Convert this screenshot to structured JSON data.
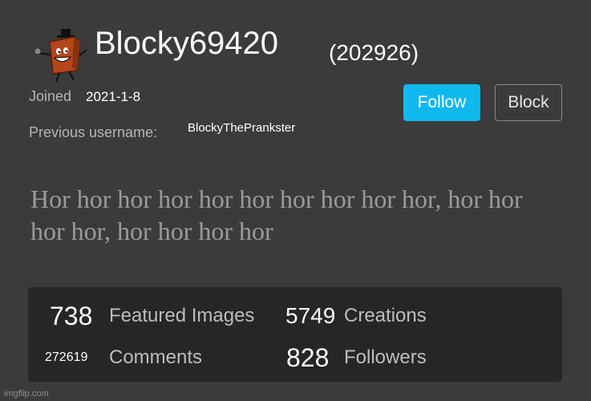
{
  "profile": {
    "username": "Blocky69420",
    "user_id": "(202926)",
    "joined_label": "Joined",
    "joined_date": "2021-1-8",
    "previous_username_label": "Previous username:",
    "previous_username": "BlockyThePrankster",
    "bio": "Hor hor hor hor hor hor hor hor hor hor, hor hor hor hor, hor hor hor hor"
  },
  "actions": {
    "follow_label": "Follow",
    "block_label": "Block"
  },
  "stats": {
    "featured_count": "738",
    "featured_label": "Featured Images",
    "creations_count": "5749",
    "creations_label": "Creations",
    "comments_count": "272619",
    "comments_label": "Comments",
    "followers_count": "828",
    "followers_label": "Followers"
  },
  "watermark": "imgflip.com",
  "colors": {
    "background": "#3b3b3b",
    "follow_button": "#0fb8ee",
    "stats_panel": "#262626",
    "bio_text": "#9a9a9a"
  },
  "icons": {
    "avatar": "brown-block-character-icon"
  }
}
